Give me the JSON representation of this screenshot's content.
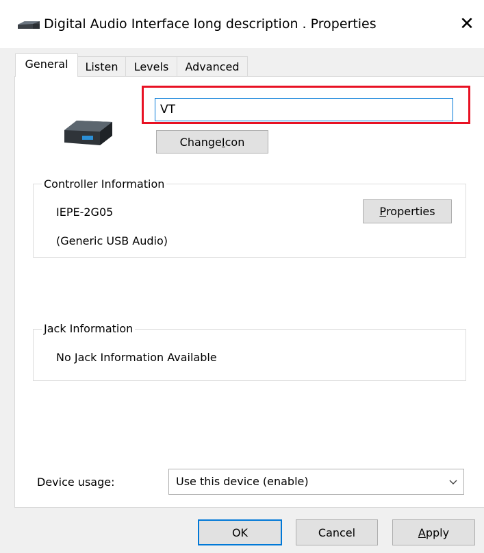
{
  "window": {
    "title": "Digital Audio Interface long description . Properties",
    "close_label": "✕"
  },
  "tabs": [
    {
      "label": "General",
      "active": true
    },
    {
      "label": "Listen",
      "active": false
    },
    {
      "label": "Levels",
      "active": false
    },
    {
      "label": "Advanced",
      "active": false
    }
  ],
  "general": {
    "device_name_value": "VT",
    "change_icon": {
      "before": "Change ",
      "accel": "I",
      "after": "con"
    },
    "controller": {
      "legend": "Controller Information",
      "name": "IEPE-2G05",
      "driver": "(Generic USB Audio)",
      "properties": {
        "before": "",
        "accel": "P",
        "after": "roperties"
      }
    },
    "jack": {
      "legend": "Jack Information",
      "text": "No Jack Information Available"
    },
    "device_usage": {
      "label": "Device usage:",
      "selected": "Use this device (enable)"
    }
  },
  "buttons": {
    "ok": "OK",
    "cancel": "Cancel",
    "apply": {
      "before": "",
      "accel": "A",
      "after": "pply"
    }
  },
  "colors": {
    "highlight": "#e81123",
    "focus_border": "#0078d7",
    "dialog_bg": "#f0f0f0"
  },
  "icons": [
    "speaker-device-icon",
    "close-icon",
    "audio-device-icon",
    "chevron-down-icon"
  ]
}
